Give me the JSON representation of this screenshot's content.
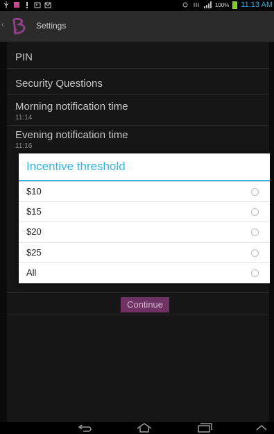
{
  "status_bar": {
    "time": "11:13 AM",
    "battery_percent": "100%",
    "icons_left": [
      "usb-icon",
      "notification-icon",
      "alert-icon",
      "image-icon",
      "mail-icon"
    ],
    "icons_right": [
      "wifi-icon",
      "data-icon",
      "signal-icon",
      "battery-icon"
    ]
  },
  "action_bar": {
    "title": "Settings",
    "back_icon": "chevron-left-icon",
    "logo_icon": "app-logo-icon"
  },
  "settings": {
    "pin": "PIN",
    "security_questions": "Security Questions",
    "morning": {
      "title": "Morning notification time",
      "value": "11:14"
    },
    "evening": {
      "title": "Evening notification time",
      "value": "11:16"
    },
    "continue_label": "Continue"
  },
  "dialog": {
    "title": "Incentive threshold",
    "options": [
      "$10",
      "$15",
      "$20",
      "$25",
      "All"
    ],
    "selected_index": null
  },
  "nav_bar": {
    "icons": [
      "back-icon",
      "home-icon",
      "recent-apps-icon",
      "menu-up-icon"
    ]
  },
  "colors": {
    "accent": "#33b5e5",
    "continue_bg": "#6e3363",
    "logo": "#8e3f86"
  }
}
